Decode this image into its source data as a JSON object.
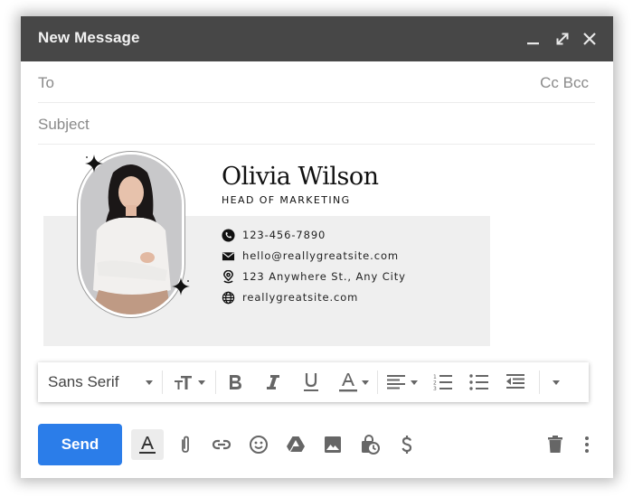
{
  "window": {
    "title": "New Message",
    "controls": [
      "minimize-icon",
      "expand-icon",
      "close-icon"
    ]
  },
  "fields": {
    "to_label": "To",
    "to_value": "",
    "cc_label": "Cc",
    "bcc_label": "Bcc",
    "subject_label": "Subject",
    "subject_value": ""
  },
  "signature": {
    "name": "Olivia Wilson",
    "role": "HEAD OF MARKETING",
    "contacts": [
      {
        "icon": "phone-icon",
        "text": "123-456-7890"
      },
      {
        "icon": "envelope-icon",
        "text": "hello@reallygreatsite.com"
      },
      {
        "icon": "location-pin-icon",
        "text": "123 Anywhere St., Any City"
      },
      {
        "icon": "globe-icon",
        "text": "reallygreatsite.com"
      }
    ],
    "colors": {
      "band": "#efefef",
      "text": "#111111"
    }
  },
  "format_toolbar": {
    "font": "Sans Serif",
    "buttons": [
      "text-size-icon",
      "bold-icon",
      "italic-icon",
      "underline-icon",
      "text-color-icon",
      "align-icon",
      "numbered-list-icon",
      "bulleted-list-icon",
      "indent-less-icon",
      "more-formatting-icon"
    ]
  },
  "bottom_bar": {
    "send_label": "Send",
    "send_color": "#2b7de9",
    "icons": [
      "formatting-options-icon",
      "attach-icon",
      "link-icon",
      "emoji-icon",
      "drive-icon",
      "insert-photo-icon",
      "confidential-mode-icon",
      "money-icon",
      "trash-icon",
      "more-options-icon"
    ]
  }
}
